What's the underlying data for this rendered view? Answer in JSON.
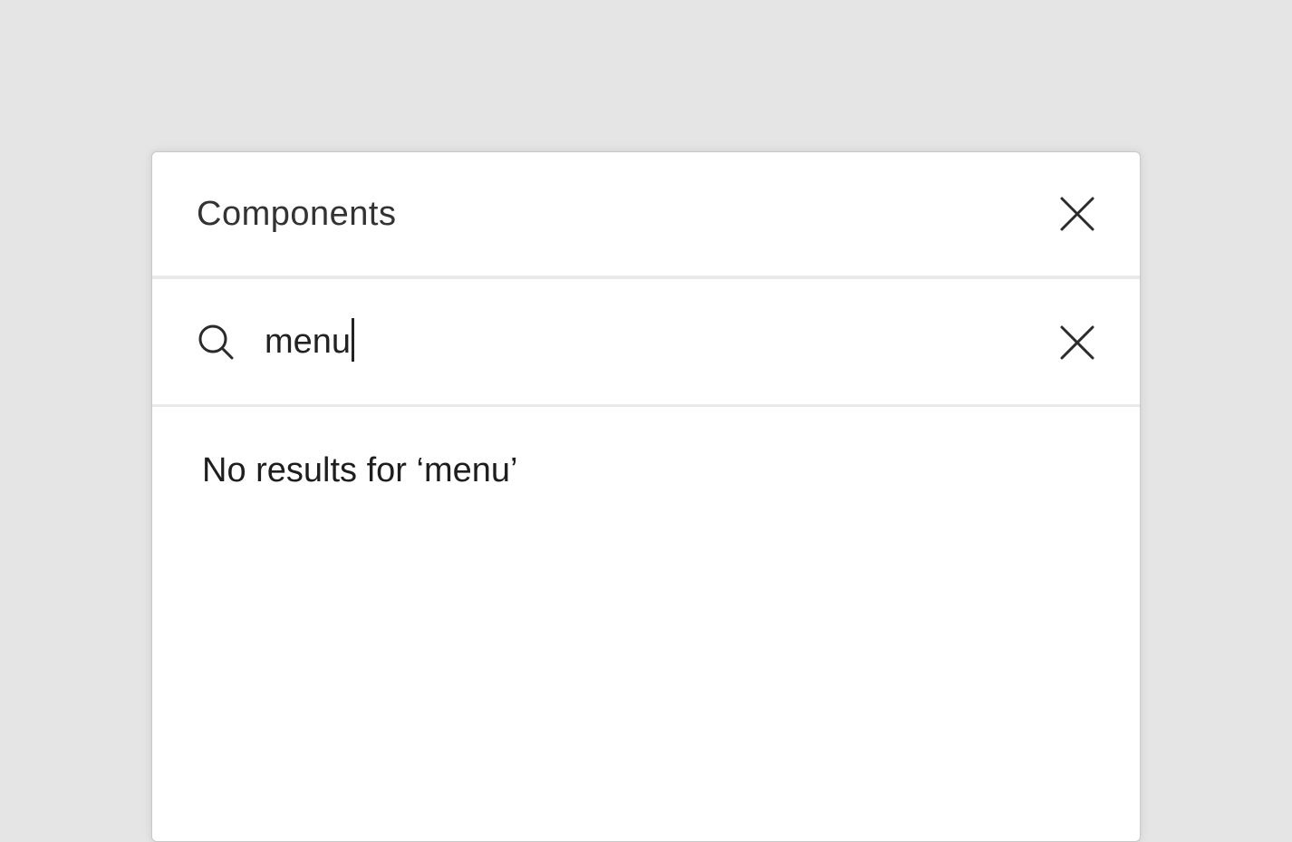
{
  "panel": {
    "title": "Components",
    "close_icon": "close-icon"
  },
  "search": {
    "value": "menu",
    "search_icon": "search-icon",
    "clear_icon": "clear-icon"
  },
  "results": {
    "empty_message": "No results for ‘menu’"
  },
  "colors": {
    "background": "#e5e5e5",
    "panel": "#ffffff",
    "divider": "#e9e9e9",
    "text": "#333333",
    "icon": "#2b2b2b"
  }
}
